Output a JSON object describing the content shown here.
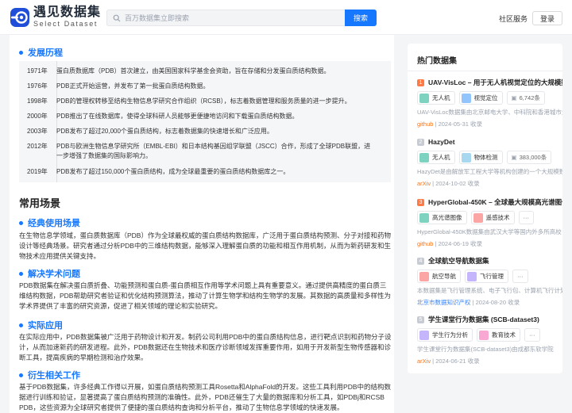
{
  "brand": {
    "name_cn": "遇见数据集",
    "name_en": "Select Dataset"
  },
  "header": {
    "search_placeholder": "百万数据集立即搜索",
    "search_button": "搜索",
    "community": "社区服务",
    "login": "登录"
  },
  "history": {
    "title": "发展历程",
    "events": [
      {
        "year": "1971年",
        "text": "蛋白质数据库（PDB）首次建立，由美国国家科学基金会资助，旨在存储和分发蛋白质结构数据。"
      },
      {
        "year": "1976年",
        "text": "PDB正式开始运营，并发布了第一批蛋白质结构数据。"
      },
      {
        "year": "1998年",
        "text": "PDB的管理权转移至结构生物信息学研究合作组织（RCSB），标志着数据管理和服务质量的进一步提升。"
      },
      {
        "year": "2000年",
        "text": "PDB推出了在线数据库，使得全球科研人员能够更便捷地访问和下载蛋白质结构数据。"
      },
      {
        "year": "2003年",
        "text": "PDB发布了超过20,000个蛋白质结构，标志着数据集的快速增长和广泛应用。"
      },
      {
        "year": "2012年",
        "text": "PDB与欧洲生物信息学研究所（EMBL-EBI）和日本结构基因组学联盟（JSCC）合作，形成了全球PDB联盟，进一步增强了数据集的国际影响力。"
      },
      {
        "year": "2019年",
        "text": "PDB发布了超过150,000个蛋白质结构，成为全球最重要的蛋白质结构数据库之一。"
      }
    ]
  },
  "scenarios": {
    "title": "常用场景",
    "sections": [
      {
        "heading": "经典使用场景",
        "body": "在生物信息学领域，蛋白质数据库（PDB）作为全球最权威的蛋白质结构数据库，广泛用于蛋白质结构预测、分子对接和药物设计等经典场景。研究者通过分析PDB中的三维结构数据，能够深入理解蛋白质的功能和相互作用机制，从而为新药研发和生物技术应用提供关键支持。"
      },
      {
        "heading": "解决学术问题",
        "body": "PDB数据集在解决蛋白质折叠、功能预测和蛋白质-蛋白质相互作用等学术问题上具有重要意义。通过提供高精度的蛋白质三维结构数据，PDB帮助研究者验证和优化结构预测算法，推动了计算生物学和结构生物学的发展。其数据的高质量和多样性为学术界提供了丰富的研究资源，促进了相关领域的理论和实验研究。"
      },
      {
        "heading": "实际应用",
        "body": "在实际应用中，PDB数据集被广泛用于药物设计和开发。制药公司利用PDB中的蛋白质结构信息，进行靶点识别和药物分子设计，从而加速新药的研发进程。此外，PDB数据还在生物技术和医疗诊断领域发挥重要作用，如用于开发新型生物传感器和诊断工具，提高疾病的早期检测和治疗效果。"
      },
      {
        "heading": "衍生相关工作",
        "body": "基于PDB数据集，许多经典工作得以开展，如蛋白质结构预测工具Rosetta和AlphaFold的开发。这些工具利用PDB中的结构数据进行训练和验证，显著提高了蛋白质结构预测的准确性。此外，PDB还催生了大量的数据库和分析工具，如PDBj和RCSB PDB，这些资源为全球研究者提供了便捷的蛋白质结构查询和分析平台，推动了生物信息学领域的快速发展。"
      }
    ]
  },
  "sidebar": {
    "title": "热门数据集",
    "items": [
      {
        "rank": "1",
        "name": "UAV-VisLoc – 用于无人机视觉定位的大规模数据集",
        "tags": [
          "无人机",
          "视觉定位"
        ],
        "count": "6,742条",
        "more": "",
        "desc": "UAV-VisLoc数据集由北京邮电大学、中科院和香港城市大学",
        "source": "github",
        "date": "2024-05-31 收录"
      },
      {
        "rank": "2",
        "name": "HazyDet",
        "tags": [
          "无人机",
          "物体检测"
        ],
        "count": "383,000条",
        "more": "",
        "desc": "HazyDet是由解放军工程大学等机构创建的一个大规模数据集",
        "source": "arXiv",
        "date": "2024-10-02 收录"
      },
      {
        "rank": "3",
        "name": "HyperGlobal-450K – 全球最大规模高光谱图像数据集",
        "tags": [
          "高光谱图像",
          "遥感技术"
        ],
        "count": "",
        "more": "···",
        "desc": "HyperGlobal-450K数据集由武汉大学等国内外多所高校",
        "source": "github",
        "date": "2024-06-19 收录"
      },
      {
        "rank": "4",
        "name": "全球航空导航数据集",
        "tags": [
          "航空导航",
          "飞行管理"
        ],
        "count": "",
        "more": "···",
        "desc": "本数据集是飞行管理系统、电子飞行包、计算机飞行计划",
        "source": "北京市数据知识产权",
        "date": "2024-08-20 收录"
      },
      {
        "rank": "5",
        "name": "学生课堂行为数据集 (SCB-dataset3)",
        "tags": [
          "学生行为分析",
          "教育技术"
        ],
        "count": "",
        "more": "···",
        "desc": "学生课堂行为数据集(SCB-dataset3)由成都东软学院",
        "source": "arXiv",
        "date": "2024-06-21 收录"
      }
    ]
  },
  "colors": {
    "primary": "#1677ff",
    "rank_top": "#ff7a45",
    "rank_other": "#c7cbd3",
    "source": "#f97316"
  }
}
